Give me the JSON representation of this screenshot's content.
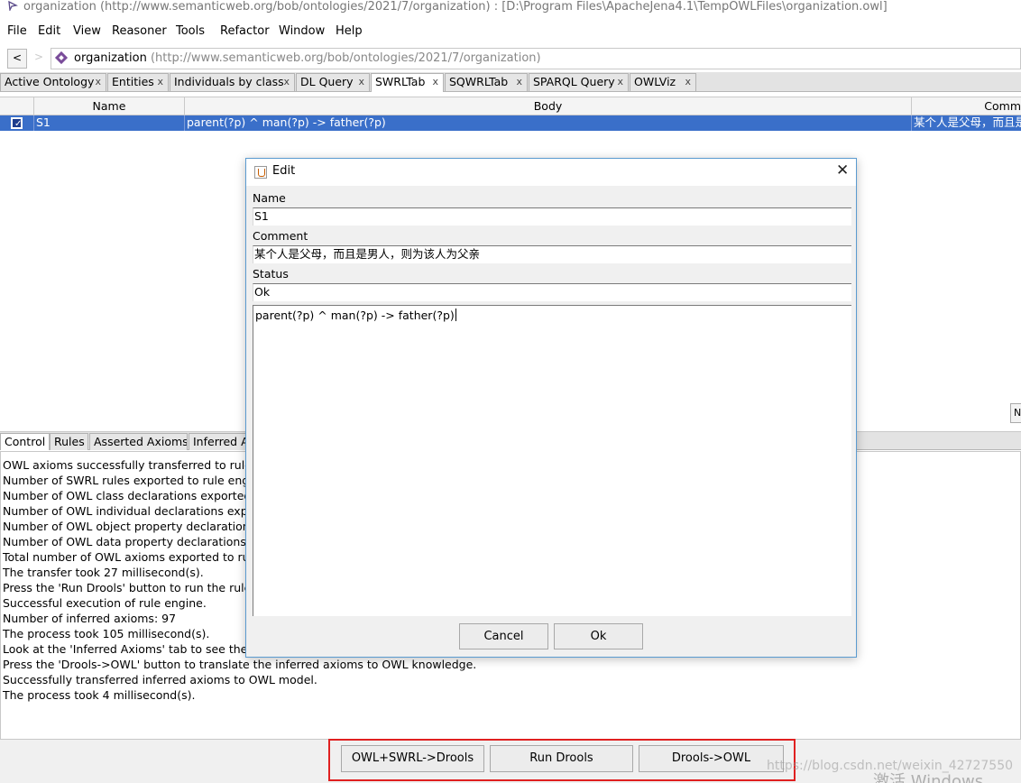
{
  "window": {
    "title": "organization (http://www.semanticweb.org/bob/ontologies/2021/7/organization)  : [D:\\Program Files\\ApacheJena4.1\\TempOWLFiles\\organization.owl]"
  },
  "menu": [
    "File",
    "Edit",
    "View",
    "Reasoner",
    "Tools",
    "Refactor",
    "Window",
    "Help"
  ],
  "address": {
    "back_label": "<",
    "forward_label": ">",
    "ontology_name": "organization",
    "ontology_iri": "(http://www.semanticweb.org/bob/ontologies/2021/7/organization)"
  },
  "tabs": [
    {
      "label": "Active Ontology",
      "active": false
    },
    {
      "label": "Entities",
      "active": false
    },
    {
      "label": "Individuals by class",
      "active": false
    },
    {
      "label": "DL Query",
      "active": false
    },
    {
      "label": "SWRLTab",
      "active": true
    },
    {
      "label": "SQWRLTab",
      "active": false
    },
    {
      "label": "SPARQL Query",
      "active": false
    },
    {
      "label": "OWLViz",
      "active": false
    }
  ],
  "tab_close_glyph": "x",
  "rules_table": {
    "headers": [
      "Name",
      "Body",
      "Comm"
    ],
    "rows": [
      {
        "enabled": true,
        "name": "S1",
        "body": "parent(?p) ^ man(?p) -> father(?p)",
        "comment": "某个人是父母，而且是"
      }
    ]
  },
  "right_stub": "N",
  "bottom_tabs": [
    {
      "label": "Control",
      "active": true
    },
    {
      "label": "Rules",
      "active": false
    },
    {
      "label": "Asserted Axioms",
      "active": false
    },
    {
      "label": "Inferred A",
      "active": false
    }
  ],
  "console_lines": [
    "OWL axioms successfully transferred to rule er",
    "Number of SWRL rules exported to rule engine",
    "Number of OWL class declarations exported t",
    "Number of OWL individual declarations export",
    "Number of OWL object property declarations",
    "Number of OWL data property declarations ex",
    "Total number of OWL axioms exported to rule",
    "The transfer took 27 millisecond(s).",
    "Press the 'Run Drools' button to run the rule er",
    "Successful execution of rule engine.",
    "Number of inferred axioms: 97",
    "The process took 105 millisecond(s).",
    "Look at the 'Inferred Axioms' tab to see the int",
    "Press the 'Drools->OWL' button to translate the inferred axioms to OWL knowledge.",
    "Successfully transferred inferred axioms to OWL model.",
    "The process took 4 millisecond(s)."
  ],
  "actions": {
    "owl_to_drools": "OWL+SWRL->Drools",
    "run_drools": "Run Drools",
    "drools_to_owl": "Drools->OWL"
  },
  "highlight_color": "#e02020",
  "watermark": "https://blog.csdn.net/weixin_42727550",
  "activate_windows": "激活 Windows",
  "dialog": {
    "title": "Edit",
    "close_glyph": "✕",
    "name_label": "Name",
    "name_value": "S1",
    "comment_label": "Comment",
    "comment_value": "某个人是父母，而且是男人，则为该人为父亲",
    "status_label": "Status",
    "status_value": "Ok",
    "body_value": "parent(?p) ^ man(?p) -> father(?p)",
    "cancel_label": "Cancel",
    "ok_label": "Ok"
  }
}
